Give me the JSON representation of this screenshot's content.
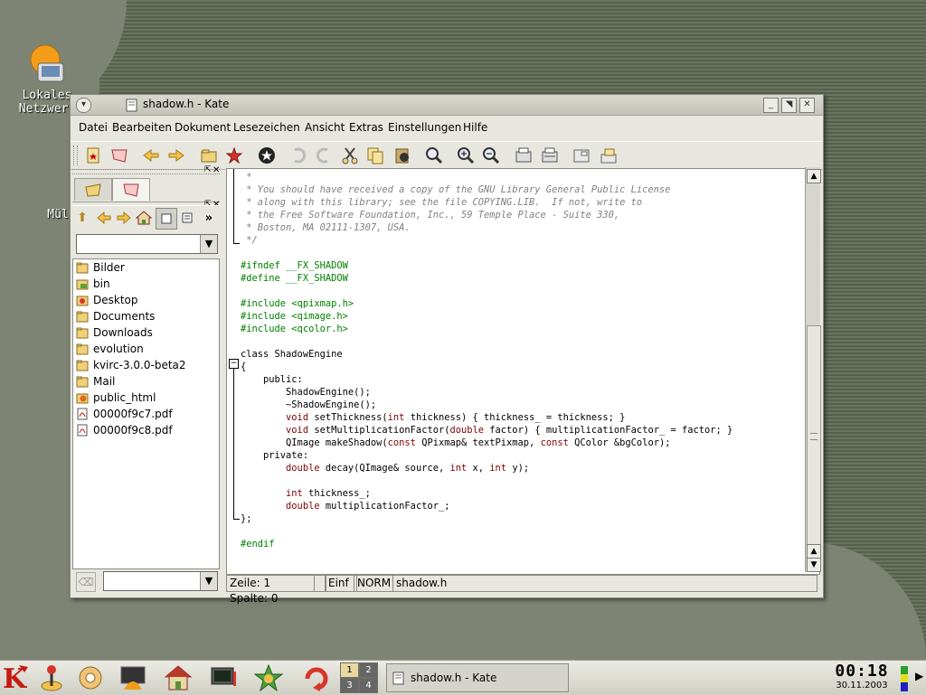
{
  "desktop": {
    "icons": [
      {
        "label": "Lokales",
        "label2": "Netzwerk",
        "icon": "network-monitor-icon"
      },
      {
        "label": "Mül",
        "icon": "trash-icon"
      }
    ]
  },
  "window": {
    "title": "shadow.h - Kate",
    "menu": [
      "Datei",
      "Bearbeiten",
      "Dokument",
      "Lesezeichen",
      "Ansicht",
      "Extras",
      "Einstellungen",
      "Hilfe"
    ],
    "toolbar_icons": [
      "new-icon",
      "close-doc-icon",
      "back-icon",
      "forward-icon",
      "open-icon",
      "new-star-icon",
      "stop-icon",
      "undo-icon",
      "redo-icon",
      "cut-icon",
      "copy-icon",
      "paste-icon",
      "find-icon",
      "zoom-in-icon",
      "zoom-out-icon",
      "print-icon",
      "print-preview-icon",
      "save-icon",
      "save-as-icon"
    ]
  },
  "sidebar": {
    "tabs": [
      "filelist-tab",
      "filesystem-tab"
    ],
    "nav_icons": [
      "up-icon",
      "back-icon",
      "forward-icon",
      "home-icon",
      "detail-view-icon",
      "short-view-icon",
      "more-icon"
    ],
    "path_value": "",
    "filter_value": "",
    "files": [
      {
        "name": "Bilder",
        "icon": "folder-icon"
      },
      {
        "name": "bin",
        "icon": "folder-icon"
      },
      {
        "name": "Desktop",
        "icon": "desktop-folder-icon"
      },
      {
        "name": "Documents",
        "icon": "folder-icon"
      },
      {
        "name": "Downloads",
        "icon": "folder-icon"
      },
      {
        "name": "evolution",
        "icon": "folder-icon"
      },
      {
        "name": "kvirc-3.0.0-beta2",
        "icon": "folder-icon"
      },
      {
        "name": "Mail",
        "icon": "folder-icon"
      },
      {
        "name": "public_html",
        "icon": "web-folder-icon"
      },
      {
        "name": "00000f9c7.pdf",
        "icon": "pdf-icon"
      },
      {
        "name": "00000f9c8.pdf",
        "icon": "pdf-icon"
      }
    ]
  },
  "editor": {
    "lines": [
      [
        {
          "t": " *",
          "c": "cm"
        }
      ],
      [
        {
          "t": " * You should have received a copy of the GNU Library General Public License",
          "c": "cm"
        }
      ],
      [
        {
          "t": " * along with this library; see the file COPYING.LIB.  If not, write to",
          "c": "cm"
        }
      ],
      [
        {
          "t": " * the Free Software Foundation, Inc., 59 Temple Place - Suite 330,",
          "c": "cm"
        }
      ],
      [
        {
          "t": " * Boston, MA 02111-1307, USA.",
          "c": "cm"
        }
      ],
      [
        {
          "t": " */",
          "c": "cm"
        }
      ],
      [],
      [
        {
          "t": "#ifndef __FX_SHADOW",
          "c": "pp"
        }
      ],
      [
        {
          "t": "#define __FX_SHADOW",
          "c": "pp"
        }
      ],
      [],
      [
        {
          "t": "#include <qpixmap.h>",
          "c": "pp"
        }
      ],
      [
        {
          "t": "#include <qimage.h>",
          "c": "pp"
        }
      ],
      [
        {
          "t": "#include <qcolor.h>",
          "c": "pp"
        }
      ],
      [],
      [
        {
          "t": "class ShadowEngine",
          "c": "pl"
        }
      ],
      [
        {
          "t": "{",
          "c": "pl"
        }
      ],
      [
        {
          "t": "    public:",
          "c": "pl"
        }
      ],
      [
        {
          "t": "        ShadowEngine();",
          "c": "pl"
        }
      ],
      [
        {
          "t": "        ~ShadowEngine();",
          "c": "pl"
        }
      ],
      [
        {
          "t": "        ",
          "c": "pl"
        },
        {
          "t": "void",
          "c": "ty"
        },
        {
          "t": " setThickness(",
          "c": "pl"
        },
        {
          "t": "int",
          "c": "ty"
        },
        {
          "t": " thickness) { thickness_ = thickness; }",
          "c": "pl"
        }
      ],
      [
        {
          "t": "        ",
          "c": "pl"
        },
        {
          "t": "void",
          "c": "ty"
        },
        {
          "t": " setMultiplicationFactor(",
          "c": "pl"
        },
        {
          "t": "double",
          "c": "ty"
        },
        {
          "t": " factor) { multiplicationFactor_ = factor; }",
          "c": "pl"
        }
      ],
      [
        {
          "t": "        QImage makeShadow(",
          "c": "pl"
        },
        {
          "t": "const",
          "c": "ty"
        },
        {
          "t": " QPixmap& textPixmap, ",
          "c": "pl"
        },
        {
          "t": "const",
          "c": "ty"
        },
        {
          "t": " QColor &bgColor);",
          "c": "pl"
        }
      ],
      [
        {
          "t": "    private:",
          "c": "pl"
        }
      ],
      [
        {
          "t": "        ",
          "c": "pl"
        },
        {
          "t": "double",
          "c": "ty"
        },
        {
          "t": " decay(QImage& source, ",
          "c": "pl"
        },
        {
          "t": "int",
          "c": "ty"
        },
        {
          "t": " x, ",
          "c": "pl"
        },
        {
          "t": "int",
          "c": "ty"
        },
        {
          "t": " y);",
          "c": "pl"
        }
      ],
      [],
      [
        {
          "t": "        ",
          "c": "pl"
        },
        {
          "t": "int",
          "c": "ty"
        },
        {
          "t": " thickness_;",
          "c": "pl"
        }
      ],
      [
        {
          "t": "        ",
          "c": "pl"
        },
        {
          "t": "double",
          "c": "ty"
        },
        {
          "t": " multiplicationFactor_;",
          "c": "pl"
        }
      ],
      [
        {
          "t": "};",
          "c": "pl"
        }
      ],
      [],
      [
        {
          "t": "#endif",
          "c": "pp"
        }
      ]
    ]
  },
  "status": {
    "position": "Zeile: 1 Spalte: 0",
    "insert_mode": "Einf",
    "select_mode": "NORM",
    "filename": "shadow.h"
  },
  "taskbar": {
    "launchers": [
      "kde-k-menu-icon",
      "joystick-icon",
      "kcontrol-icon",
      "konsole-shell-icon",
      "home-icon",
      "terminal-icon",
      "star-icon",
      "update-icon"
    ],
    "desktops": [
      "1",
      "2",
      "3",
      "4"
    ],
    "task_title": "shadow.h - Kate",
    "time": "00:18",
    "date": "30.11.2003"
  }
}
